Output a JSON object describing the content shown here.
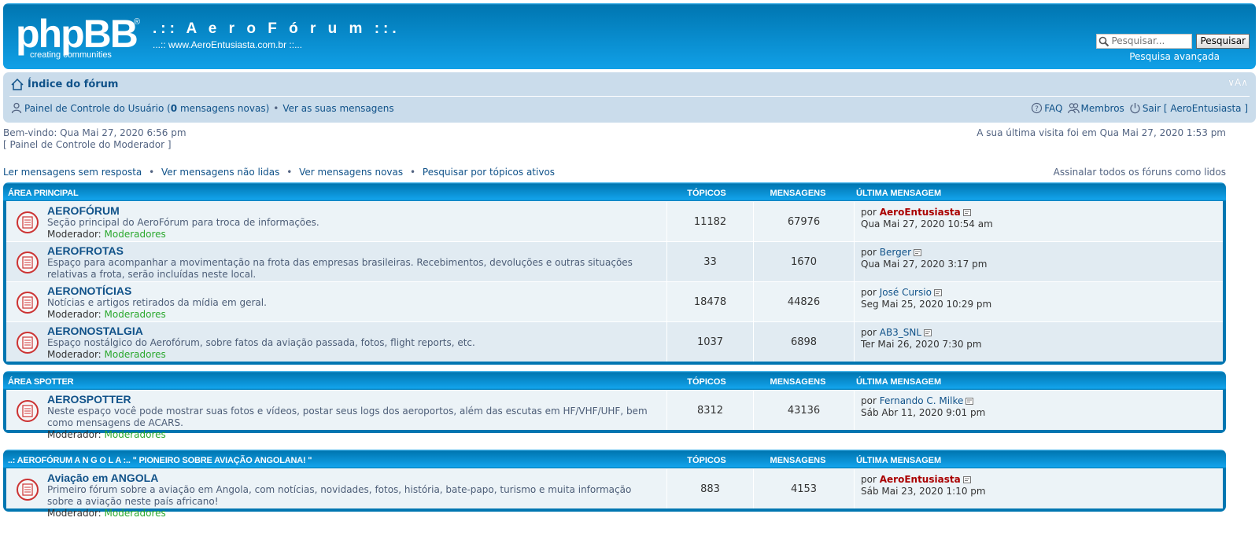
{
  "header": {
    "logo_main": "phpBB",
    "logo_reg": "®",
    "logo_tagline": "creating   communities",
    "site_title": ".:: A e r o F ó r u m ::.",
    "site_desc": "...:: www.AeroEntusiasta.com.br ::...",
    "search_placeholder": "Pesquisar...",
    "search_button": "Pesquisar",
    "advanced_search": "Pesquisa avançada"
  },
  "navbar": {
    "breadcrumb": "Índice do fórum",
    "font_resize": "∨A∧",
    "ucp_prefix": "Painel de Controle do Usuário (",
    "ucp_count": "0",
    "ucp_suffix": " mensagens novas)",
    "view_posts": "Ver as suas mensagens",
    "faq": "FAQ",
    "members": "Membros",
    "logout": "Sair [ AeroEntusiasta ]"
  },
  "info": {
    "welcome": "Bem-vindo: Qua Mai 27, 2020 6:56 pm",
    "mcp": "[ Painel de Controle do Moderador ]",
    "last_visit": "A sua última visita foi em Qua Mai 27, 2020 1:53 pm",
    "links": [
      "Ler mensagens sem resposta",
      "Ver mensagens não lidas",
      "Ver mensagens novas",
      "Pesquisar por tópicos ativos"
    ],
    "mark_read": "Assinalar todos os fóruns como lidos"
  },
  "column_labels": {
    "topics": "TÓPICOS",
    "posts": "MENSAGENS",
    "last": "ÚLTIMA MENSAGEM"
  },
  "moderator_label": "Moderador:",
  "moderator_link": "Moderadores",
  "by": "por",
  "categories": [
    {
      "name": "ÁREA PRINCIPAL",
      "forums": [
        {
          "title": "AEROFÓRUM",
          "desc": "Seção principal do AeroFórum para troca de informações.",
          "topics": "11182",
          "posts": "67976",
          "last_user": "AeroEntusiasta",
          "last_date": "Qua Mai 27, 2020 10:54 am"
        },
        {
          "title": "AEROFROTAS",
          "desc": "Espaço para acompanhar a movimentação na frota das empresas brasileiras. Recebimentos, devoluções e outras situações relativas a frota, serão incluídas neste local.",
          "topics": "33",
          "posts": "1670",
          "last_user": "Berger",
          "last_date": "Qua Mai 27, 2020 3:17 pm"
        },
        {
          "title": "AERONOTÍCIAS",
          "desc": "Notícias e artigos retirados da mídia em geral.",
          "topics": "18478",
          "posts": "44826",
          "last_user": "José Cursio",
          "last_date": "Seg Mai 25, 2020 10:29 pm"
        },
        {
          "title": "AERONOSTALGIA",
          "desc": "Espaço nostálgico do Aerofórum, sobre fatos da aviação passada, fotos, flight reports, etc.",
          "topics": "1037",
          "posts": "6898",
          "last_user": "AB3_SNL",
          "last_date": "Ter Mai 26, 2020 7:30 pm"
        }
      ]
    },
    {
      "name": "ÁREA SPOTTER",
      "forums": [
        {
          "title": "AEROSPOTTER",
          "desc": "Neste espaço você pode mostrar suas fotos e vídeos, postar seus logs dos aeroportos, além das escutas em HF/VHF/UHF, bem como mensagens de ACARS.",
          "topics": "8312",
          "posts": "43136",
          "last_user": "Fernando C. Milke",
          "last_date": "Sáb Abr 11, 2020 9:01 pm"
        }
      ]
    },
    {
      "name": "..: AEROFÓRUM A N G O L A :.. \" PIONEIRO SOBRE AVIAÇÃO ANGOLANA! \"",
      "forums": [
        {
          "title": "Aviação em ANGOLA",
          "desc": "Primeiro fórum sobre a aviação em Angola, com notícias, novidades, fotos, história, bate-papo, turismo e muita informação sobre a aviação neste país africano!",
          "topics": "883",
          "posts": "4153",
          "last_user": "AeroEntusiasta",
          "last_date": "Sáb Mai 23, 2020 1:10 pm"
        }
      ]
    }
  ]
}
